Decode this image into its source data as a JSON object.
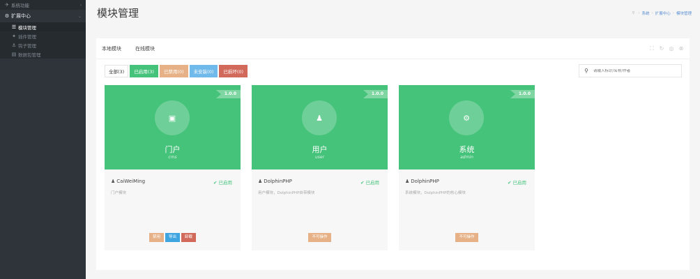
{
  "sidebar": {
    "top_item": {
      "icon": "paper-plane-icon",
      "label": "系统功能"
    },
    "group": {
      "icon": "gear-icon",
      "label": "扩展中心"
    },
    "items": [
      {
        "icon": "list-icon",
        "label": "模块管理",
        "active": true
      },
      {
        "icon": "puzzle-icon",
        "label": "插件管理",
        "active": false
      },
      {
        "icon": "anchor-icon",
        "label": "钩子管理",
        "active": false
      },
      {
        "icon": "database-icon",
        "label": "数据包管理",
        "active": false
      }
    ]
  },
  "header": {
    "title": "模块管理",
    "breadcrumb": [
      "系统",
      "扩展中心",
      "模块管理"
    ]
  },
  "tabs": [
    "本地模块",
    "在线模块"
  ],
  "filters": [
    {
      "label": "全部(3)",
      "color": "#ffffff"
    },
    {
      "label": "已启用(3)",
      "color": "#46c37b"
    },
    {
      "label": "已禁用(0)",
      "color": "#e6b186"
    },
    {
      "label": "未安装(0)",
      "color": "#70b9eb"
    },
    {
      "label": "已损坏(0)",
      "color": "#d26a5c"
    }
  ],
  "search": {
    "placeholder": "请输入标识/名称/作者"
  },
  "accent_color": "#46c37b",
  "modules": [
    {
      "version": "1.0.0",
      "name": "门户",
      "code": "cms",
      "icon": "newspaper-icon",
      "author": "CaiWeiMing",
      "status": "已启用",
      "desc": "门户模块",
      "actions": [
        "禁用",
        "导出",
        "卸载"
      ]
    },
    {
      "version": "1.0.0",
      "name": "用户",
      "code": "user",
      "icon": "user-icon",
      "author": "DolphinPHP",
      "status": "已启用",
      "desc": "用户模块，DolphinPHP自带模块",
      "actions": [
        "不可操作"
      ]
    },
    {
      "version": "1.0.0",
      "name": "系统",
      "code": "admin",
      "icon": "gear-icon",
      "author": "DolphinPHP",
      "status": "已启用",
      "desc": "系统模块，DolphinPHP的核心模块",
      "actions": [
        "不可操作"
      ]
    }
  ]
}
